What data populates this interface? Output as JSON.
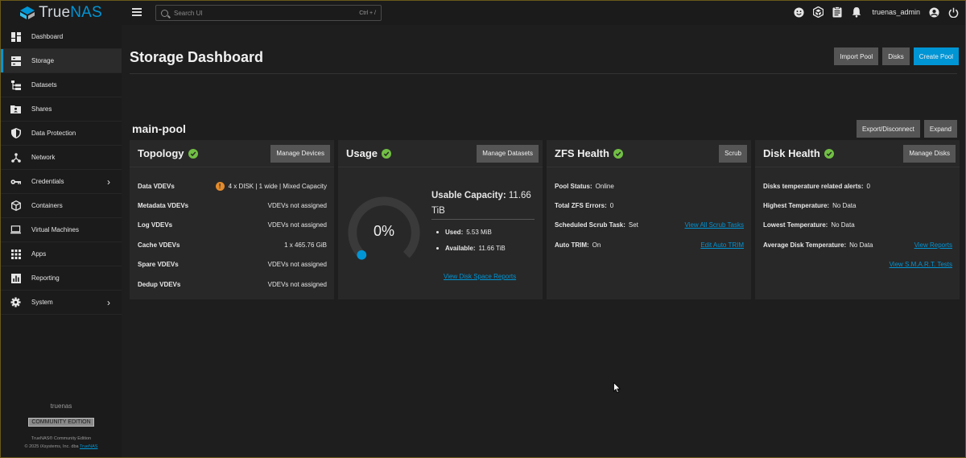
{
  "brand": {
    "name_prefix": "True",
    "name_suffix": "NAS"
  },
  "search": {
    "placeholder": "Search UI",
    "shortcut": "Ctrl + /"
  },
  "topbar": {
    "username": "truenas_admin"
  },
  "sidebar": {
    "items": [
      {
        "label": "Dashboard",
        "icon": "dashboard-icon"
      },
      {
        "label": "Storage",
        "icon": "storage-icon",
        "active": true
      },
      {
        "label": "Datasets",
        "icon": "datasets-icon"
      },
      {
        "label": "Shares",
        "icon": "shares-icon"
      },
      {
        "label": "Data Protection",
        "icon": "shield-icon"
      },
      {
        "label": "Network",
        "icon": "network-icon"
      },
      {
        "label": "Credentials",
        "icon": "key-icon",
        "has_children": true
      },
      {
        "label": "Containers",
        "icon": "cube-icon"
      },
      {
        "label": "Virtual Machines",
        "icon": "laptop-icon"
      },
      {
        "label": "Apps",
        "icon": "apps-grid-icon"
      },
      {
        "label": "Reporting",
        "icon": "chart-icon"
      },
      {
        "label": "System",
        "icon": "gear-icon",
        "has_children": true
      }
    ],
    "footer": {
      "hostname": "truenas",
      "edition_badge": "COMMUNITY EDITION",
      "product_line": "TrueNAS® Community Edition",
      "copyright_prefix": "© 2025 iXsystems, Inc. dba ",
      "copyright_link": "TrueNAS"
    }
  },
  "page": {
    "title": "Storage Dashboard",
    "buttons": {
      "import": "Import Pool",
      "disks": "Disks",
      "create": "Create Pool"
    }
  },
  "pool": {
    "name": "main-pool",
    "buttons": {
      "export": "Export/Disconnect",
      "expand": "Expand"
    },
    "topology": {
      "title": "Topology",
      "button": "Manage Devices",
      "rows": [
        {
          "key": "Data VDEVs",
          "value": "4 x DISK | 1 wide | Mixed Capacity",
          "warning": true
        },
        {
          "key": "Metadata VDEVs",
          "value": "VDEVs not assigned"
        },
        {
          "key": "Log VDEVs",
          "value": "VDEVs not assigned"
        },
        {
          "key": "Cache VDEVs",
          "value": "1 x 465.76 GiB"
        },
        {
          "key": "Spare VDEVs",
          "value": "VDEVs not assigned"
        },
        {
          "key": "Dedup VDEVs",
          "value": "VDEVs not assigned"
        }
      ]
    },
    "usage": {
      "title": "Usage",
      "button": "Manage Datasets",
      "percent_label": "0%",
      "percent_value": 0,
      "capacity_label": "Usable Capacity:",
      "capacity_value": "11.66 TiB",
      "used_label": "Used:",
      "used_value": "5.53 MiB",
      "available_label": "Available:",
      "available_value": "11.66 TiB",
      "link": "View Disk Space Reports"
    },
    "zfs_health": {
      "title": "ZFS Health",
      "button": "Scrub",
      "rows": [
        {
          "key": "Pool Status:",
          "value": "Online"
        },
        {
          "key": "Total ZFS Errors:",
          "value": "0"
        },
        {
          "key": "Scheduled Scrub Task:",
          "value": "Set",
          "link": "View All Scrub Tasks"
        },
        {
          "key": "Auto TRIM:",
          "value": "On",
          "link": "Edit Auto TRIM"
        }
      ]
    },
    "disk_health": {
      "title": "Disk Health",
      "button": "Manage Disks",
      "rows": [
        {
          "key": "Disks temperature related alerts:",
          "value": "0"
        },
        {
          "key": "Highest Temperature:",
          "value": "No Data"
        },
        {
          "key": "Lowest Temperature:",
          "value": "No Data"
        },
        {
          "key": "Average Disk Temperature:",
          "value": "No Data",
          "link": "View Reports"
        }
      ],
      "extra_link": "View S.M.A.R.T. Tests"
    }
  },
  "colors": {
    "accent": "#0095d5",
    "ok": "#71bf44",
    "warning": "#e38b2c",
    "bg": "#1e1e1e",
    "card": "#282828"
  }
}
